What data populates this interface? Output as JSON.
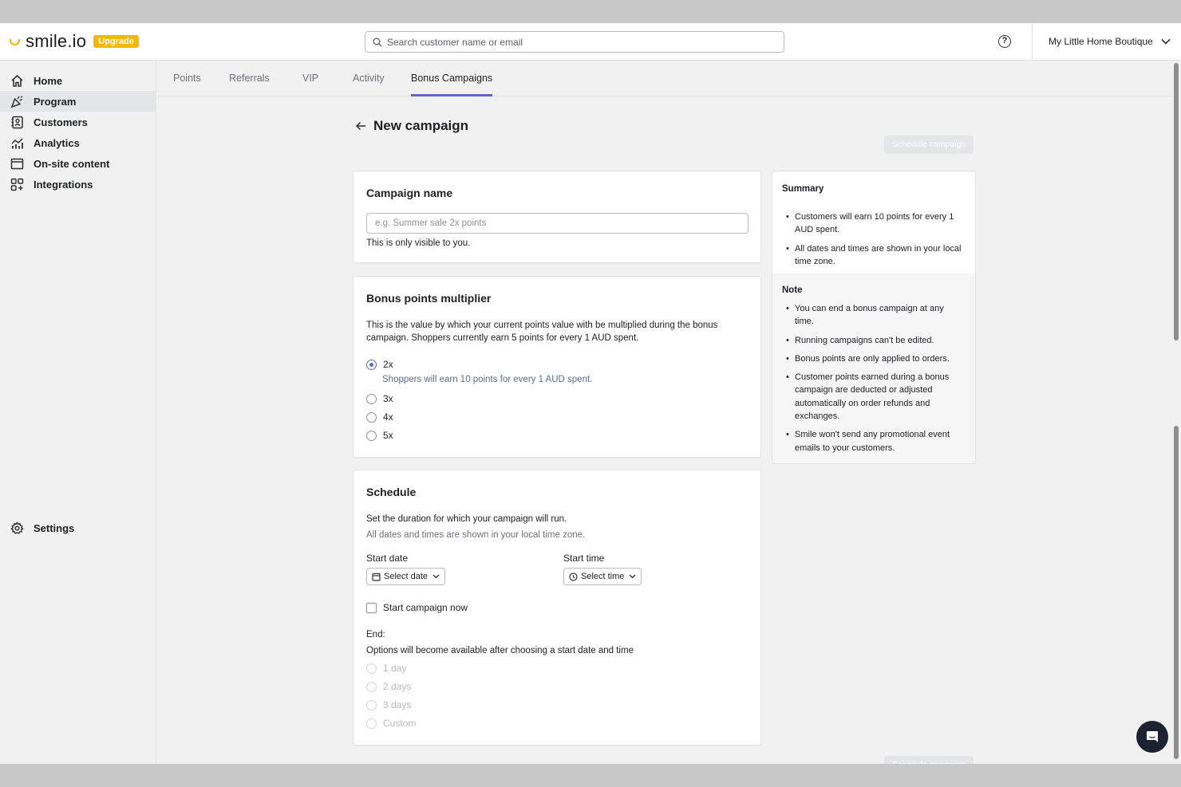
{
  "brand": {
    "name": "smile.io",
    "upgrade_label": "Upgrade",
    "accent": "#5c6ac4",
    "upgrade_color": "#f5b800"
  },
  "header": {
    "search_placeholder": "Search customer name or email",
    "store_name": "My Little Home Boutique"
  },
  "sidebar": {
    "items": [
      {
        "label": "Home",
        "icon": "home-icon"
      },
      {
        "label": "Program",
        "icon": "party-icon",
        "active": true
      },
      {
        "label": "Customers",
        "icon": "contacts-icon"
      },
      {
        "label": "Analytics",
        "icon": "analytics-icon"
      },
      {
        "label": "On-site content",
        "icon": "browser-icon"
      },
      {
        "label": "Integrations",
        "icon": "apps-icon"
      }
    ],
    "settings_label": "Settings"
  },
  "tabs": [
    {
      "label": "Points"
    },
    {
      "label": "Referrals"
    },
    {
      "label": "VIP"
    },
    {
      "label": "Activity"
    },
    {
      "label": "Bonus Campaigns",
      "active": true
    }
  ],
  "page": {
    "title": "New campaign",
    "schedule_button": "Schedule campaign"
  },
  "campaign_name": {
    "title": "Campaign name",
    "placeholder": "e.g. Summer sale 2x points",
    "helper": "This is only visible to you."
  },
  "multiplier": {
    "title": "Bonus points multiplier",
    "description": "This is the value by which your current points value with be multiplied during the bonus campaign. Shoppers currently earn 5 points for every 1 AUD spent.",
    "options": [
      "2x",
      "3x",
      "4x",
      "5x"
    ],
    "selected": "2x",
    "selected_hint": "Shoppers will earn 10 points for every 1 AUD spent."
  },
  "schedule": {
    "title": "Schedule",
    "description": "Set the duration for which your campaign will run.",
    "timezone_note": "All dates and times are shown in your local time zone.",
    "start_date_label": "Start date",
    "start_date_button": "Select date",
    "start_time_label": "Start time",
    "start_time_button": "Select time",
    "start_now_label": "Start campaign now",
    "end_label": "End:",
    "end_hint": "Options will become available after choosing a start date and time",
    "end_options": [
      "1 day",
      "2 days",
      "3 days",
      "Custom"
    ]
  },
  "summary": {
    "title": "Summary",
    "items": [
      "Customers will earn 10 points for every 1 AUD spent.",
      "All dates and times are shown in your local time zone."
    ],
    "note_title": "Note",
    "notes": [
      "You can end a bonus campaign at any time.",
      "Running campaigns can't be edited.",
      "Bonus points are only applied to orders.",
      "Customer points earned during a bonus campaign are deducted or adjusted automatically on order refunds and exchanges.",
      "Smile won't send any promotional event emails to your customers."
    ]
  }
}
